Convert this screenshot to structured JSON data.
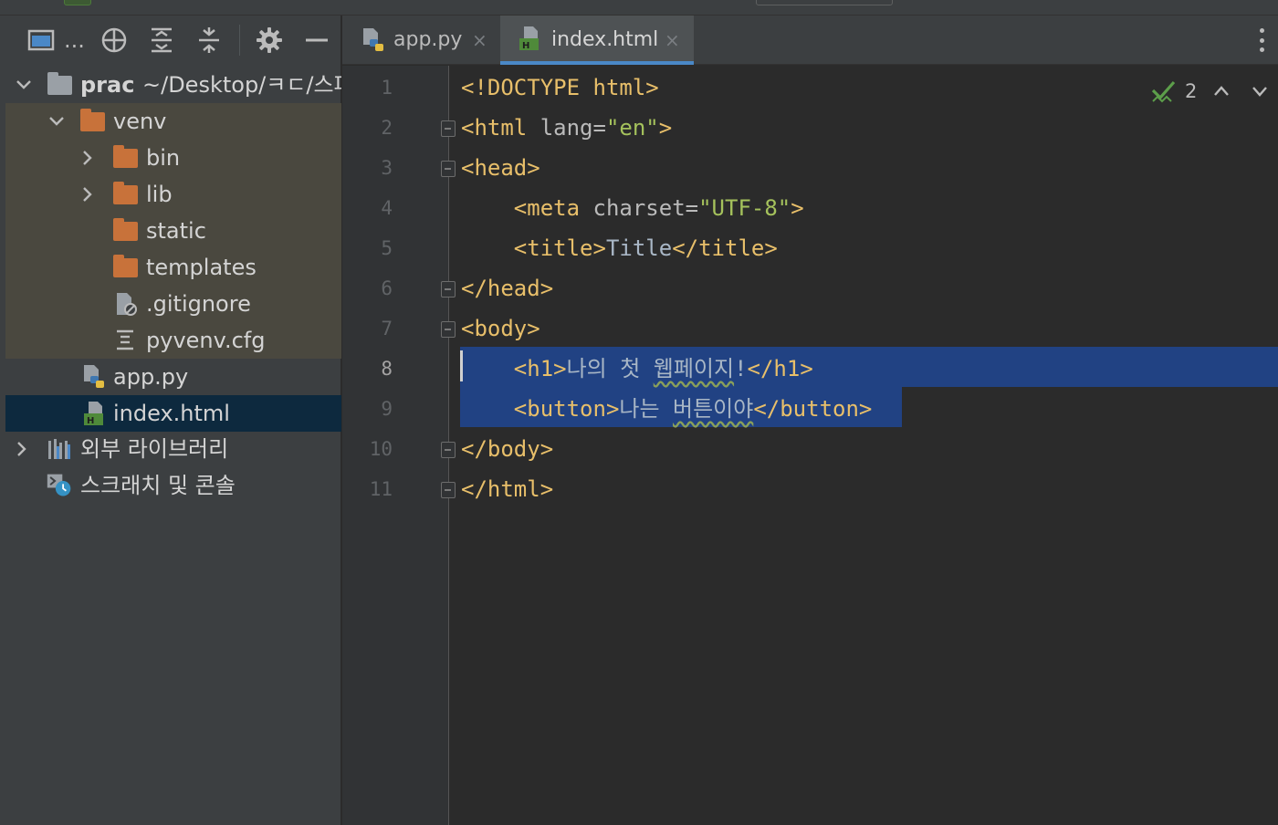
{
  "project": {
    "tree": [
      {
        "label": "prac",
        "path": "~/Desktop/ㅋㄷ/스파",
        "icon": "folder-icon"
      },
      {
        "label": "venv",
        "icon": "folder-icon"
      },
      {
        "label": "bin",
        "icon": "folder-icon"
      },
      {
        "label": "lib",
        "icon": "folder-icon"
      },
      {
        "label": "static",
        "icon": "folder-icon"
      },
      {
        "label": "templates",
        "icon": "folder-icon"
      },
      {
        "label": ".gitignore",
        "icon": "ignore-file-icon"
      },
      {
        "label": "pyvenv.cfg",
        "icon": "config-file-icon"
      },
      {
        "label": "app.py",
        "icon": "python-file-icon"
      },
      {
        "label": "index.html",
        "icon": "html-file-icon"
      },
      {
        "label": "외부 라이브러리",
        "icon": "library-icon"
      },
      {
        "label": "스크래치 및 콘솔",
        "icon": "scratch-icon"
      }
    ],
    "toolbar_more": "..."
  },
  "tabs": [
    {
      "label": "app.py",
      "close": "×",
      "active": false
    },
    {
      "label": "index.html",
      "close": "×",
      "active": true
    }
  ],
  "editor": {
    "line_numbers": [
      "1",
      "2",
      "3",
      "4",
      "5",
      "6",
      "7",
      "8",
      "9",
      "10",
      "11"
    ],
    "current_line": "8",
    "inspection_count": "2",
    "lines": [
      [
        {
          "t": "tag",
          "v": "<!DOCTYPE html>"
        }
      ],
      [
        {
          "t": "tag",
          "v": "<html "
        },
        {
          "t": "attr",
          "v": "lang="
        },
        {
          "t": "str",
          "v": "\"en\""
        },
        {
          "t": "tag",
          "v": ">"
        }
      ],
      [
        {
          "t": "tag",
          "v": "<head>"
        }
      ],
      [
        {
          "t": "txt",
          "v": "    "
        },
        {
          "t": "tag",
          "v": "<meta "
        },
        {
          "t": "attr",
          "v": "charset="
        },
        {
          "t": "str",
          "v": "\"UTF-8\""
        },
        {
          "t": "tag",
          "v": ">"
        }
      ],
      [
        {
          "t": "txt",
          "v": "    "
        },
        {
          "t": "tag",
          "v": "<title>"
        },
        {
          "t": "txt",
          "v": "Title"
        },
        {
          "t": "tag",
          "v": "</title>"
        }
      ],
      [
        {
          "t": "tag",
          "v": "</head>"
        }
      ],
      [
        {
          "t": "tag",
          "v": "<body>"
        }
      ],
      [
        {
          "t": "txt",
          "v": "    "
        },
        {
          "t": "tag",
          "v": "<h1>"
        },
        {
          "t": "txt",
          "v": "나의 첫 "
        },
        {
          "t": "ko",
          "v": "웹페이지"
        },
        {
          "t": "txt",
          "v": "!"
        },
        {
          "t": "tag",
          "v": "</h1>"
        }
      ],
      [
        {
          "t": "txt",
          "v": "    "
        },
        {
          "t": "tag",
          "v": "<button>"
        },
        {
          "t": "txt",
          "v": "나는 "
        },
        {
          "t": "ko",
          "v": "버튼이야"
        },
        {
          "t": "tag",
          "v": "</button>"
        }
      ],
      [
        {
          "t": "tag",
          "v": "</body>"
        }
      ],
      [
        {
          "t": "tag",
          "v": "</html>"
        }
      ]
    ]
  }
}
